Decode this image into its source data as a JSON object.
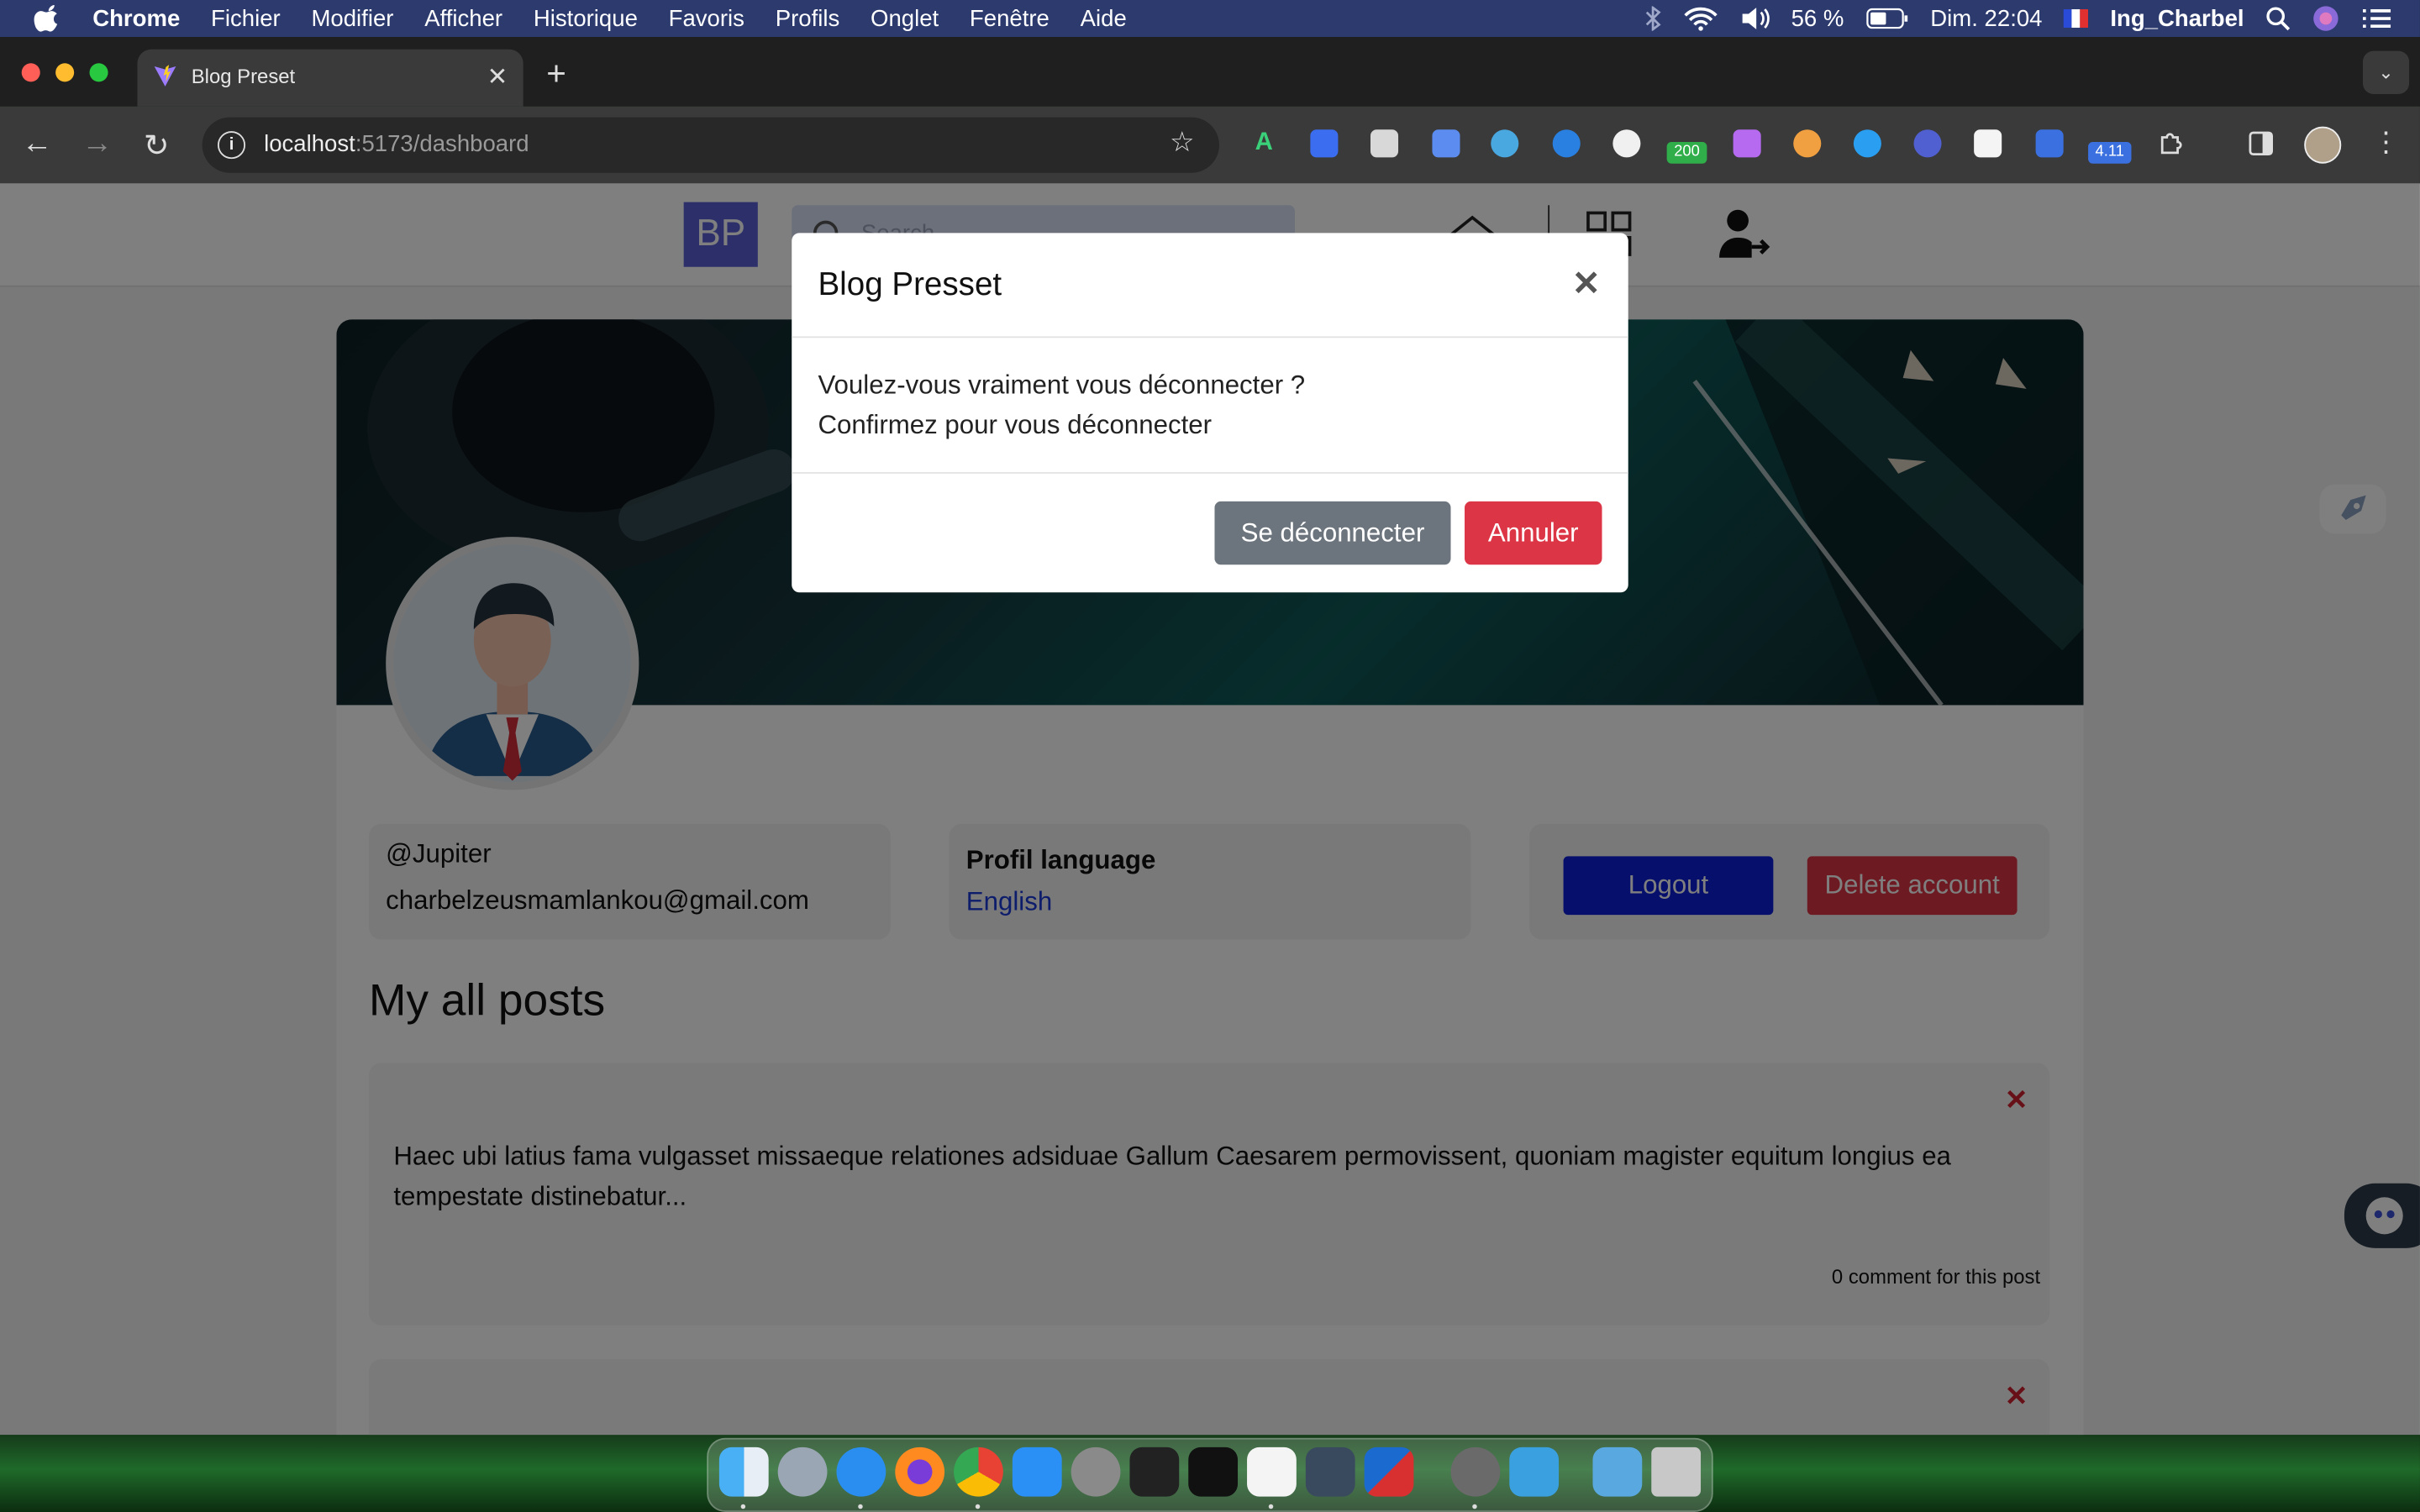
{
  "menubar": {
    "app": "Chrome",
    "items": [
      "Fichier",
      "Modifier",
      "Afficher",
      "Historique",
      "Favoris",
      "Profils",
      "Onglet",
      "Fenêtre",
      "Aide"
    ],
    "battery": "56 %",
    "clock": "Dim. 22:04",
    "user": "Ing_Charbel"
  },
  "browser": {
    "tab_title": "Blog Preset",
    "url_host": "localhost",
    "url_path": ":5173/dashboard",
    "ext_badge_1": "200",
    "ext_badge_2": "4.11"
  },
  "app": {
    "logo": "BP",
    "search_placeholder": "Search"
  },
  "profile": {
    "username": "@Jupiter",
    "email": "charbelzeusmamlankou@gmail.com",
    "language_label": "Profil language",
    "language_value": "English",
    "logout_label": "Logout",
    "delete_label": "Delete account"
  },
  "posts": {
    "title": "My all posts",
    "items": [
      {
        "text": "Haec ubi latius fama vulgasset missaeque relationes adsiduae Gallum Caesarem permovissent, quoniam magister equitum longius ea tempestate distinebatur...",
        "comments": "0 comment for this post"
      }
    ]
  },
  "modal": {
    "title": "Blog Presset",
    "line1": "Voulez-vous vraiment vous déconnecter ?",
    "line2": "Confirmez pour vous déconnecter",
    "confirm_label": "Se déconnecter",
    "cancel_label": "Annuler"
  },
  "colors": {
    "primary_blue": "#0c1fd6",
    "danger_red": "#dc3545",
    "secondary_gray": "#6c757d",
    "logo_purple": "#5a5fd6"
  }
}
